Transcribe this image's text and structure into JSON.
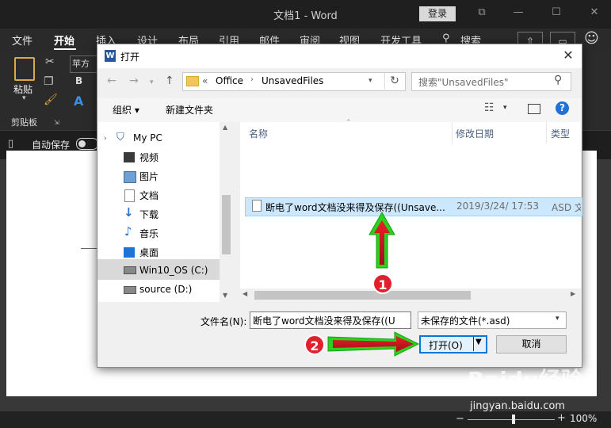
{
  "word": {
    "title": "文档1 - Word",
    "login_label": "登录",
    "tabs": [
      "文件",
      "开始",
      "插入",
      "设计",
      "布局",
      "引用",
      "邮件",
      "审阅",
      "视图",
      "开发工具",
      "搜索"
    ],
    "font_name": "苹方",
    "paste_label": "粘贴",
    "clipboard_label": "剪贴板",
    "autosave_label": "自动保存",
    "zoom": "100%"
  },
  "dialog": {
    "title": "打开",
    "breadcrumb": [
      "«",
      "Office",
      "UnsavedFiles"
    ],
    "search_placeholder": "搜索\"UnsavedFiles\"",
    "organize_label": "组织 ▾",
    "new_folder_label": "新建文件夹",
    "help_label": "?",
    "tree_items": [
      {
        "label": "My PC",
        "icon": "pc-icon"
      },
      {
        "label": "视频",
        "icon": "video-folder-icon"
      },
      {
        "label": "图片",
        "icon": "pictures-folder-icon"
      },
      {
        "label": "文档",
        "icon": "documents-folder-icon"
      },
      {
        "label": "下载",
        "icon": "downloads-folder-icon"
      },
      {
        "label": "音乐",
        "icon": "music-folder-icon"
      },
      {
        "label": "桌面",
        "icon": "desktop-folder-icon"
      },
      {
        "label": "Win10_OS (C:)",
        "icon": "drive-icon"
      },
      {
        "label": "source (D:)",
        "icon": "drive-icon"
      }
    ],
    "columns": [
      "名称",
      "修改日期",
      "类型"
    ],
    "files": [
      {
        "name": "断电了word文档没来得及保存((Unsave...",
        "modified": "2019/3/24/ 17:53",
        "type": "ASD 文"
      }
    ],
    "filename_label": "文件名(N):",
    "filename_value": "断电了word文档没来得及保存((U",
    "filetype_value": "未保存的文件(*.asd)",
    "open_label": "打开(O)",
    "cancel_label": "取消"
  },
  "annotations": {
    "badge1": "1",
    "badge2": "2"
  },
  "watermark": {
    "text": "Baidu经验",
    "url": "jingyan.baidu.com"
  },
  "colors": {
    "accent": "#2b579a",
    "selection": "#cce8ff",
    "arrow_green": "#22c01a",
    "badge_red": "#e0202c"
  }
}
